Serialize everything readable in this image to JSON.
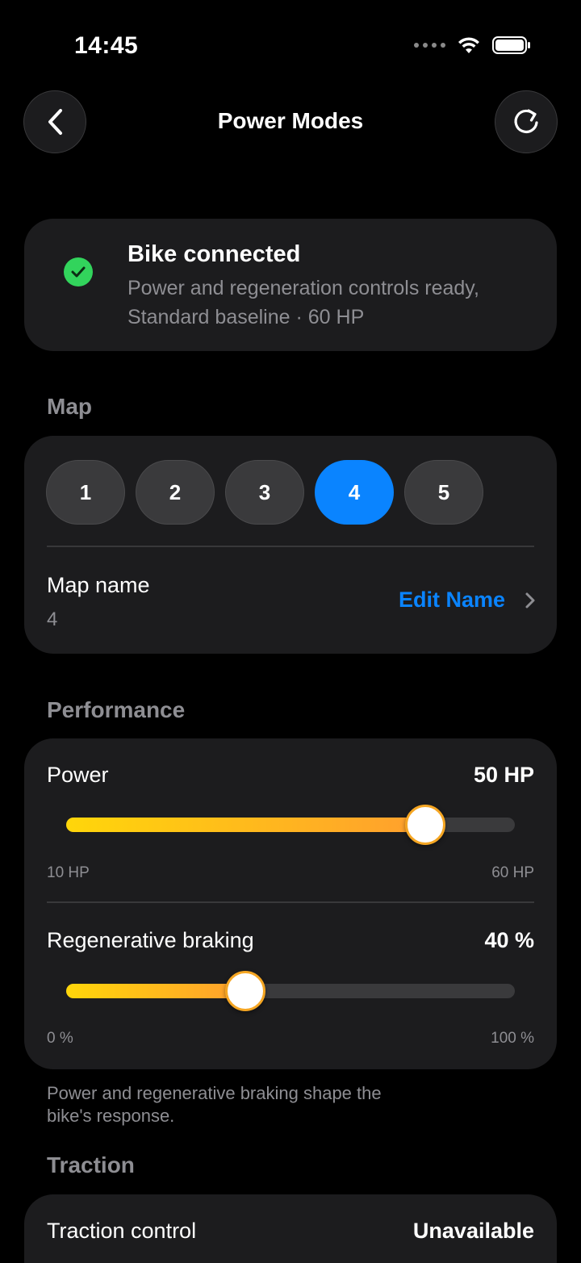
{
  "status_bar": {
    "time": "14:45"
  },
  "nav": {
    "title": "Power Modes"
  },
  "connection": {
    "title": "Bike connected",
    "line1": "Power and regeneration controls ready,",
    "line2": "Standard baseline · 60 HP"
  },
  "map": {
    "section_label": "Map",
    "options": [
      "1",
      "2",
      "3",
      "4",
      "5"
    ],
    "selected": "4",
    "name_label": "Map name",
    "name_value": "4",
    "edit_label": "Edit Name"
  },
  "performance": {
    "section_label": "Performance",
    "power": {
      "label": "Power",
      "value": "50 HP",
      "min_label": "10 HP",
      "max_label": "60 HP",
      "fraction": 0.8
    },
    "regen": {
      "label": "Regenerative braking",
      "value": "40 %",
      "min_label": "0 %",
      "max_label": "100 %",
      "fraction": 0.4
    },
    "footnote_line1": "Power and regenerative braking shape the",
    "footnote_line2": "bike's response."
  },
  "traction": {
    "section_label": "Traction",
    "label": "Traction control",
    "value": "Unavailable"
  },
  "colors": {
    "accent": "#0a84ff",
    "success": "#32d45c",
    "slider_start": "#ffd60a",
    "slider_end": "#ff9f2e"
  }
}
